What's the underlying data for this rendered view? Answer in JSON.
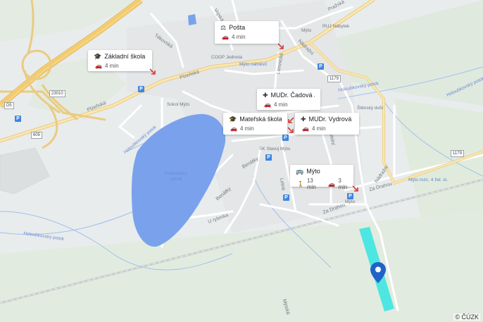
{
  "map": {
    "copyright": "© ČÚZK",
    "streets": {
      "prazska_ne": "Pražská",
      "plzenska": "Plzeňská",
      "plzenska_w": "Plzeňská",
      "tekovska": "Tékovská",
      "vojska": "Vojská",
      "nadrazni_top": "Nádražní",
      "nadrazni_right": "Nádražní",
      "lomnicka": "Lomnická",
      "benatky": "Benátky",
      "benatky2": "Benátky",
      "letna": "Letná",
      "u_rybnika": "U rybníka",
      "za_drahou": "Za Drahou",
      "za_drahou2": "Za Drahou",
      "mytska": "Mýtská",
      "slovany": "Sokolovská",
      "holou_top": "Holoubkovský potok",
      "holou_left": "Holoubkovský potok",
      "holou_bottom": "Holoubkovský potok",
      "holou_right": "Holoubkovský potok",
      "kostel": "Štěnský dvůr",
      "sokol": "Sokol Mýto",
      "sk": "SK Slavoj Mýto",
      "pond": "Podmýtský rybník",
      "ruj": "RUJ Nábytek",
      "coop": "COOP Jednota",
      "mytonam": "Mýto náměstí",
      "mytoroz": "Mýto rozc. 4 žel. st.",
      "myto_small": "Mýto",
      "myto_small2": "Mýto",
      "k_zeleznici": "Kostelní"
    },
    "road_numbers": {
      "r1": "23010",
      "r2": "1179",
      "r3": "1179",
      "r4": "605",
      "r5": "D5"
    },
    "parking_label": "P",
    "cards": [
      {
        "icon": "post-office-icon",
        "title": "Pošta",
        "time": "4 min"
      },
      {
        "icon": "school-icon",
        "title": "Základní škola M...",
        "time": "4 min"
      },
      {
        "icon": "clinic-icon",
        "title": "MUDr. Čadová Jana",
        "time": "4 min"
      },
      {
        "icon": "school-icon",
        "title": "Mateřská škola Sl...",
        "time": "4 min"
      },
      {
        "icon": "clinic-icon",
        "title": "MUDr. Vydrová K...",
        "time": "4 min"
      },
      {
        "icon": "bus-icon",
        "title": "Mýto",
        "walk_time": "13 min",
        "time": "3 min"
      }
    ],
    "colors": {
      "background": "#e9ecec",
      "water": "#7aa2ec",
      "highway": "#f6d27a",
      "highlight_area": "#4ee6e0",
      "pin": "#1f63c9"
    }
  }
}
